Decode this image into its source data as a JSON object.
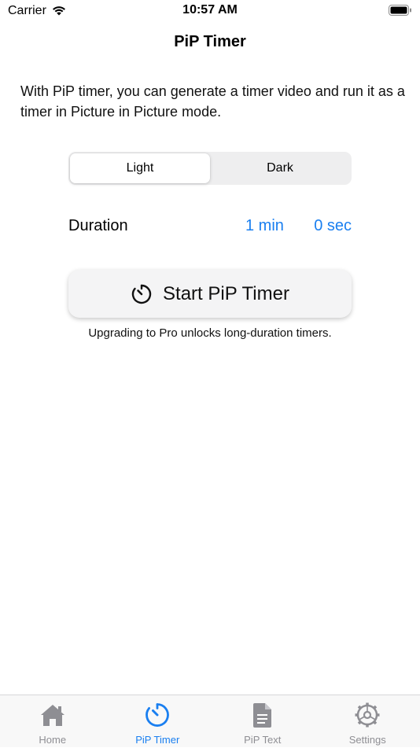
{
  "status_bar": {
    "carrier": "Carrier",
    "time": "10:57 AM"
  },
  "nav": {
    "title": "PiP Timer"
  },
  "description": "With PiP timer, you can generate a timer video and run it as a timer in Picture in Picture mode.",
  "theme_segment": {
    "options": [
      "Light",
      "Dark"
    ],
    "selected": "Light"
  },
  "duration": {
    "label": "Duration",
    "minutes": "1 min",
    "seconds": "0 sec"
  },
  "start_button": {
    "label": "Start PiP Timer",
    "icon": "timer-icon"
  },
  "upgrade_note": "Upgrading to Pro unlocks long-duration timers.",
  "tabs": [
    {
      "label": "Home",
      "icon": "house-icon",
      "active": false
    },
    {
      "label": "PiP Timer",
      "icon": "timer-icon",
      "active": true
    },
    {
      "label": "PiP Text",
      "icon": "document-icon",
      "active": false
    },
    {
      "label": "Settings",
      "icon": "gear-icon",
      "active": false
    }
  ],
  "colors": {
    "accent": "#1a7ff0",
    "inactive_tab": "#8e8e93",
    "segment_bg": "#eeeeef"
  }
}
